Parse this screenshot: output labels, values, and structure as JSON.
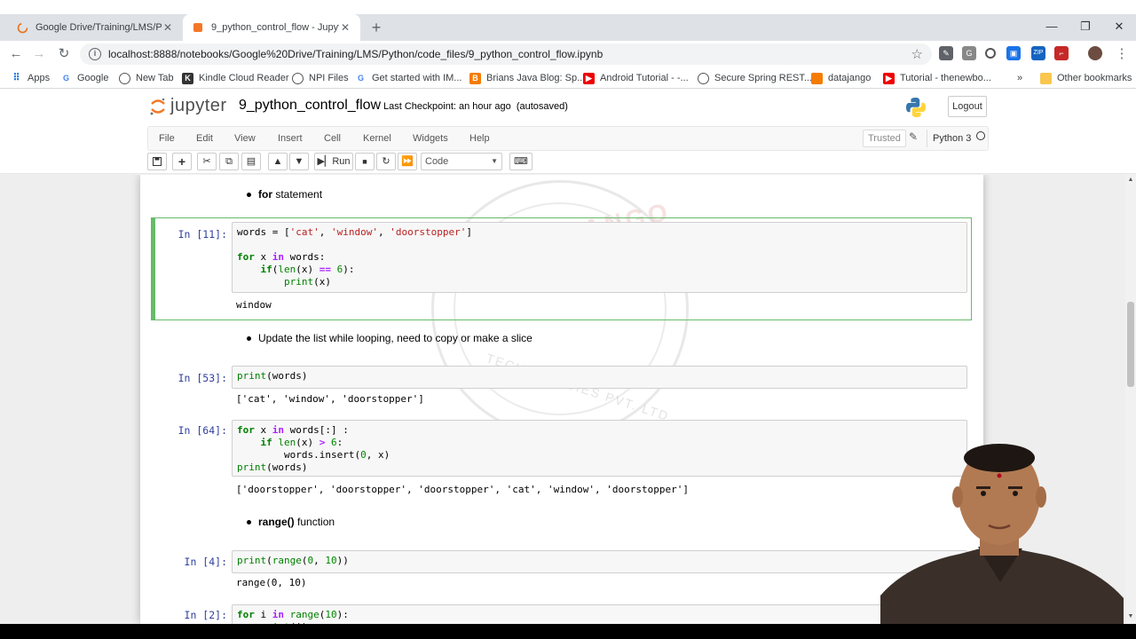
{
  "browser": {
    "tabs": [
      {
        "label": "Google Drive/Training/LMS/Pytho"
      },
      {
        "label": "9_python_control_flow - Jupyter"
      }
    ],
    "url": "localhost:8888/notebooks/Google%20Drive/Training/LMS/Python/code_files/9_python_control_flow.ipynb",
    "bookmarks": [
      "Apps",
      "Google",
      "New Tab",
      "Kindle Cloud Reader",
      "NPI Files",
      "Get started with IM...",
      "Brians Java Blog: Sp...",
      "Android Tutorial - -...",
      "Secure Spring REST...",
      "datajango",
      "Tutorial - thenewbo..."
    ],
    "other_bookmarks": "Other bookmarks",
    "more": "»"
  },
  "jupyter": {
    "logo_text": "jupyter",
    "notebook_name": "9_python_control_flow",
    "checkpoint": "Last Checkpoint: an hour ago",
    "autosave": "(autosaved)",
    "logout": "Logout",
    "menus": [
      "File",
      "Edit",
      "View",
      "Insert",
      "Cell",
      "Kernel",
      "Widgets",
      "Help"
    ],
    "trusted": "Trusted",
    "kernel": "Python 3",
    "run_label": "Run",
    "cell_type": "Code"
  },
  "notebook": {
    "md1_bold": "for",
    "md1_rest": " statement",
    "cell1_prompt": "In [11]:",
    "cell1_output": "window",
    "md2": "Update the list while looping, need to copy or make a slice",
    "cell2_prompt": "In [53]:",
    "cell2_output": "['cat', 'window', 'doorstopper']",
    "cell3_prompt": "In [64]:",
    "cell3_output": "['doorstopper', 'doorstopper', 'doorstopper', 'cat', 'window', 'doorstopper']",
    "md3_bold": "range()",
    "md3_rest": " function",
    "cell4_prompt": "In [4]:",
    "cell4_output": "range(0, 10)",
    "cell5_prompt": "In [2]:"
  },
  "watermark": {
    "top": "DATA JANGO",
    "bottom": "TECHNOLOGIES PVT. LTD."
  }
}
